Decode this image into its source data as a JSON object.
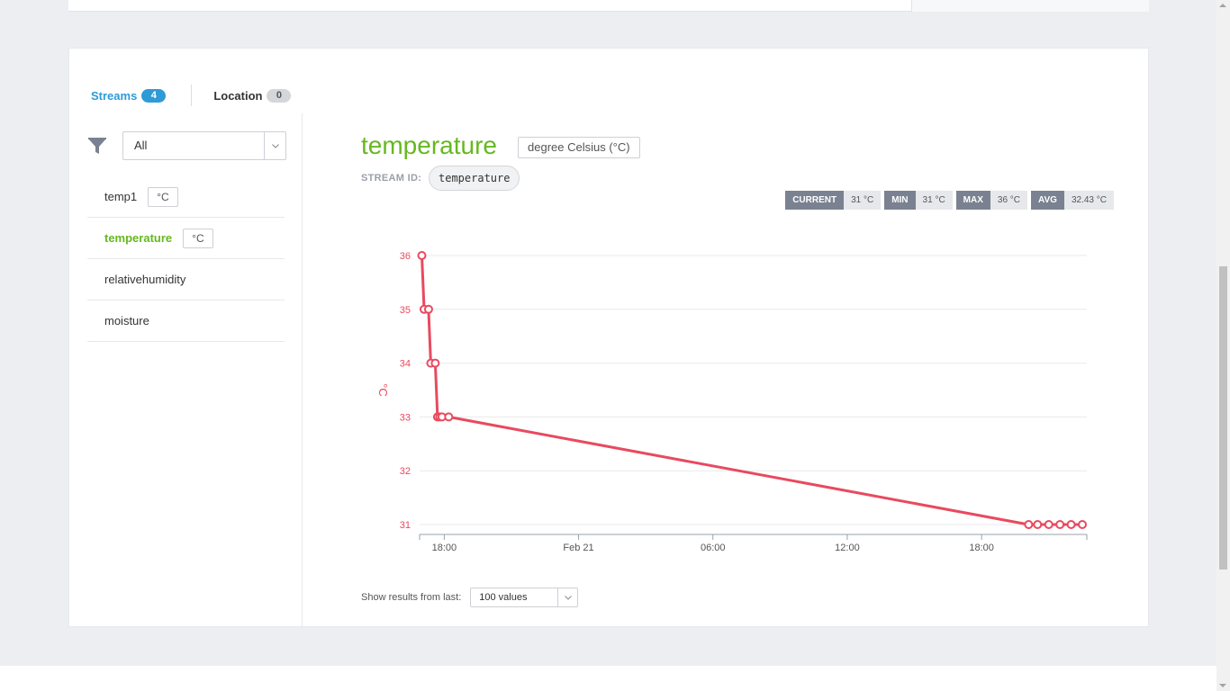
{
  "tabs": {
    "streams_label": "Streams",
    "streams_count": "4",
    "location_label": "Location",
    "location_count": "0"
  },
  "filter": {
    "selected": "All"
  },
  "streams": [
    {
      "name": "temp1",
      "unit": "°C"
    },
    {
      "name": "temperature",
      "unit": "°C",
      "active": true
    },
    {
      "name": "relativehumidity",
      "unit": ""
    },
    {
      "name": "moisture",
      "unit": ""
    }
  ],
  "detail": {
    "title": "temperature",
    "unit_long": "degree Celsius (°C)",
    "stream_id_label": "STREAM ID:",
    "stream_id": "temperature"
  },
  "stats": {
    "current_label": "CURRENT",
    "current_value": "31 °C",
    "min_label": "MIN",
    "min_value": "31 °C",
    "max_label": "MAX",
    "max_value": "36 °C",
    "avg_label": "AVG",
    "avg_value": "32.43 °C"
  },
  "results": {
    "label": "Show results from last:",
    "selected": "100 values"
  },
  "colors": {
    "accent_green": "#66b821",
    "tab_blue": "#2e9bd6",
    "series_red": "#e84a5f"
  },
  "icons": {
    "filter": "filter-funnel-icon",
    "caret": "chevron-down-icon"
  },
  "chart_data": {
    "type": "line",
    "ylabel": "°C",
    "ylim": [
      31,
      36
    ],
    "y_ticks": [
      "36",
      "35",
      "34",
      "33",
      "32",
      "31"
    ],
    "x_ticks": [
      "18:00",
      "Feb 21",
      "06:00",
      "12:00",
      "18:00"
    ],
    "x_range_hours": [
      -1.1,
      28.7
    ],
    "series": [
      {
        "points": [
          {
            "t": -1.0,
            "y": 36
          },
          {
            "t": -0.9,
            "y": 35
          },
          {
            "t": -0.7,
            "y": 35
          },
          {
            "t": -0.6,
            "y": 34
          },
          {
            "t": -0.4,
            "y": 34
          },
          {
            "t": -0.3,
            "y": 33
          },
          {
            "t": -0.2,
            "y": 33
          },
          {
            "t": -0.1,
            "y": 33
          },
          {
            "t": 0.2,
            "y": 33
          },
          {
            "t": 26.1,
            "y": 31
          },
          {
            "t": 26.5,
            "y": 31
          },
          {
            "t": 27.0,
            "y": 31
          },
          {
            "t": 27.5,
            "y": 31
          },
          {
            "t": 28.0,
            "y": 31
          },
          {
            "t": 28.5,
            "y": 31
          }
        ]
      }
    ]
  }
}
